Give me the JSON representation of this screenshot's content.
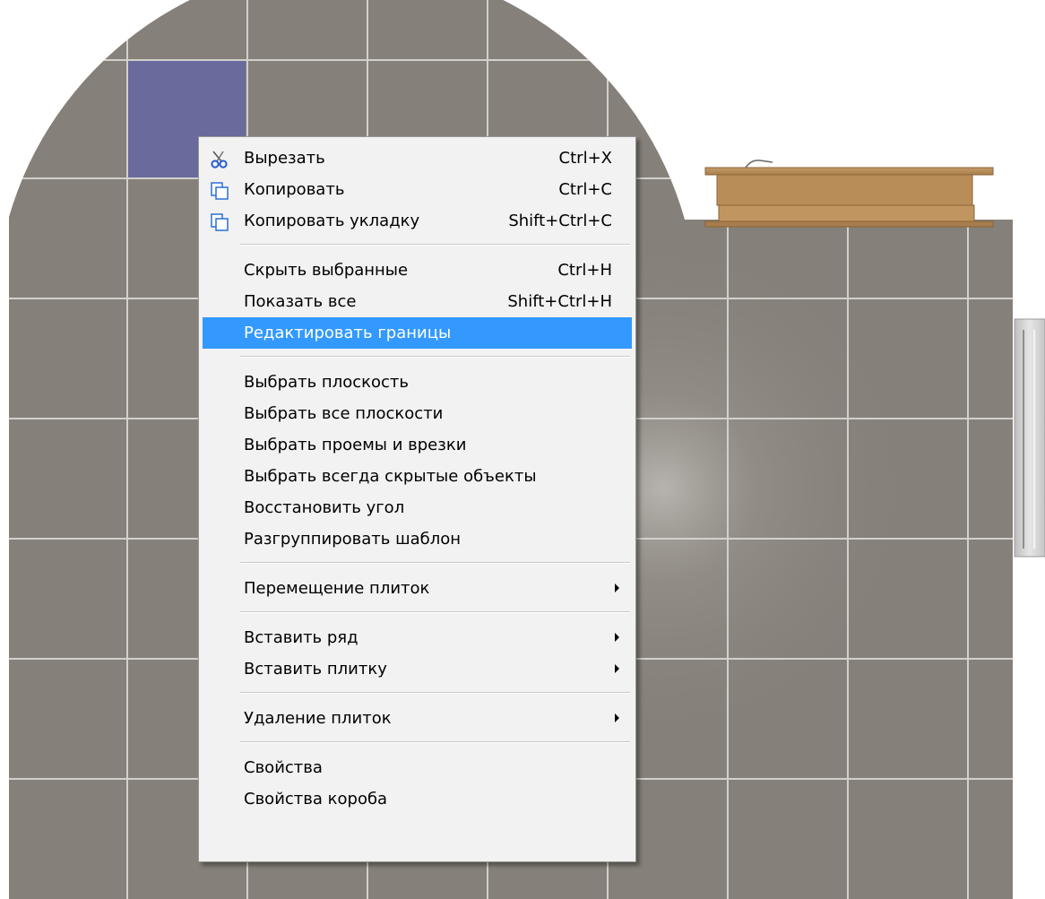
{
  "colors": {
    "tile": "#858079",
    "grout": "#cfcdc9",
    "selected_tile": "#6a6a9c",
    "menu_bg": "#f2f2f2",
    "highlight": "#3399ff",
    "wood": "#b98d58",
    "radiator": "#d4d4d4"
  },
  "menu": {
    "items": [
      {
        "id": "cut",
        "label": "Вырезать",
        "shortcut": "Ctrl+X",
        "icon": "scissors-icon"
      },
      {
        "id": "copy",
        "label": "Копировать",
        "shortcut": "Ctrl+C",
        "icon": "copy-icon"
      },
      {
        "id": "copy-layout",
        "label": "Копировать укладку",
        "shortcut": "Shift+Ctrl+C",
        "icon": "copy-icon"
      },
      {
        "id": "hide-selected",
        "label": "Скрыть выбранные",
        "shortcut": "Ctrl+H"
      },
      {
        "id": "show-all",
        "label": "Показать все",
        "shortcut": "Shift+Ctrl+H"
      },
      {
        "id": "edit-borders",
        "label": "Редактировать границы",
        "shortcut": "",
        "highlighted": true
      },
      {
        "id": "select-plane",
        "label": "Выбрать плоскость"
      },
      {
        "id": "select-all-planes",
        "label": "Выбрать все плоскости"
      },
      {
        "id": "select-openings",
        "label": "Выбрать проемы и врезки"
      },
      {
        "id": "select-hidden",
        "label": "Выбрать всегда скрытые объекты"
      },
      {
        "id": "restore-corner",
        "label": "Восстановить угол"
      },
      {
        "id": "ungroup-template",
        "label": "Разгруппировать шаблон"
      },
      {
        "id": "move-tiles",
        "label": "Перемещение плиток",
        "submenu": true
      },
      {
        "id": "insert-row",
        "label": "Вставить ряд",
        "submenu": true
      },
      {
        "id": "insert-tile",
        "label": "Вставить плитку",
        "submenu": true
      },
      {
        "id": "delete-tiles",
        "label": "Удаление плиток",
        "submenu": true
      },
      {
        "id": "properties",
        "label": "Свойства"
      },
      {
        "id": "box-properties",
        "label": "Свойства короба"
      }
    ]
  }
}
